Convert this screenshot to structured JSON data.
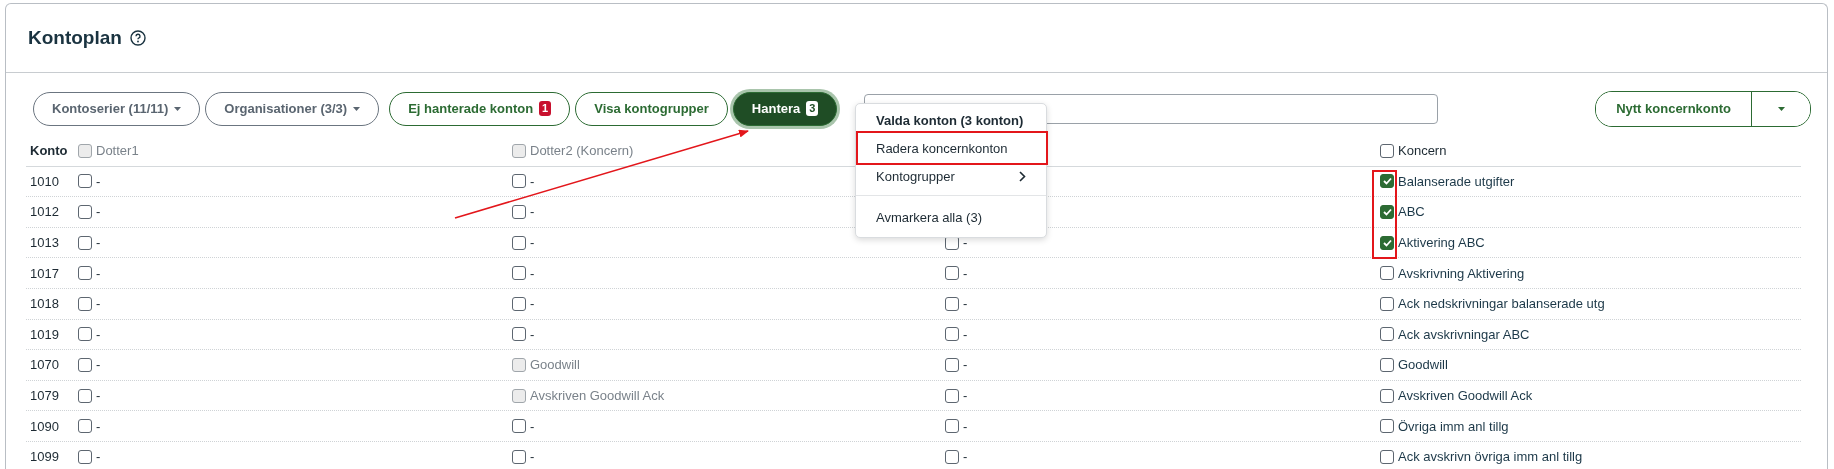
{
  "page": {
    "title": "Kontoplan"
  },
  "toolbar": {
    "buttons": [
      {
        "kind": "dropdown",
        "label": "Kontoserier (11/11)"
      },
      {
        "kind": "dropdown",
        "label": "Organisationer (3/3)"
      },
      {
        "kind": "toggle",
        "label": "Ej hanterade konton",
        "badge": "1",
        "selected": false
      },
      {
        "kind": "toggle",
        "label": "Visa kontogrupper",
        "selected": false
      },
      {
        "kind": "toggle",
        "label": "Hantera",
        "badge": "3",
        "selected": true
      }
    ],
    "new_button": {
      "label": "Nytt koncernkonto"
    }
  },
  "menu": {
    "title": "Valda konton (3 konton)",
    "items": [
      {
        "kind": "action",
        "label": "Radera koncernkonton"
      },
      {
        "kind": "submenu",
        "label": "Kontogrupper"
      },
      {
        "kind": "separator"
      },
      {
        "kind": "action",
        "label": "Avmarkera alla (3)"
      }
    ]
  },
  "table": {
    "first_column": "Konto",
    "columns": {
      "dotter1": {
        "label": "Dotter1",
        "checked": false,
        "disabled": true
      },
      "dotter2": {
        "label": "Dotter2 (Koncern)",
        "checked": false,
        "disabled": true
      },
      "koncern": {
        "label": "Koncern",
        "checked": false,
        "disabled": false
      }
    },
    "rows": [
      {
        "konto": "1010",
        "cells": {
          "dotter1": {
            "text": "-",
            "checked": false,
            "disabled": false
          },
          "dotter2": {
            "text": "-",
            "checked": false,
            "disabled": false
          },
          "koncern": {
            "text": "Balanserade utgifter",
            "checked": true,
            "disabled": false
          }
        }
      },
      {
        "konto": "1012",
        "cells": {
          "dotter1": {
            "text": "-",
            "checked": false,
            "disabled": false
          },
          "dotter2": {
            "text": "-",
            "checked": false,
            "disabled": false
          },
          "koncern": {
            "text": "ABC",
            "checked": true,
            "disabled": false
          }
        }
      },
      {
        "konto": "1013",
        "cells": {
          "dotter1": {
            "text": "-",
            "checked": false,
            "disabled": false
          },
          "dotter2": {
            "text": "-",
            "checked": false,
            "disabled": false
          },
          "column_3": {
            "text": "-",
            "checked": false,
            "disabled": false
          },
          "koncern": {
            "text": "Aktivering ABC",
            "checked": true,
            "disabled": false
          }
        }
      },
      {
        "konto": "1017",
        "cells": {
          "dotter1": {
            "text": "-",
            "checked": false,
            "disabled": false
          },
          "dotter2": {
            "text": "-",
            "checked": false,
            "disabled": false
          },
          "column_3": {
            "text": "-",
            "checked": false,
            "disabled": false
          },
          "koncern": {
            "text": "Avskrivning Aktivering",
            "checked": false,
            "disabled": false
          }
        }
      },
      {
        "konto": "1018",
        "cells": {
          "dotter1": {
            "text": "-",
            "checked": false,
            "disabled": false
          },
          "dotter2": {
            "text": "-",
            "checked": false,
            "disabled": false
          },
          "column_3": {
            "text": "-",
            "checked": false,
            "disabled": false
          },
          "koncern": {
            "text": "Ack nedskrivningar balanserade utg",
            "checked": false,
            "disabled": false
          }
        }
      },
      {
        "konto": "1019",
        "cells": {
          "dotter1": {
            "text": "-",
            "checked": false,
            "disabled": false
          },
          "dotter2": {
            "text": "-",
            "checked": false,
            "disabled": false
          },
          "column_3": {
            "text": "-",
            "checked": false,
            "disabled": false
          },
          "koncern": {
            "text": "Ack avskrivningar ABC",
            "checked": false,
            "disabled": false
          }
        }
      },
      {
        "konto": "1070",
        "cells": {
          "dotter1": {
            "text": "-",
            "checked": false,
            "disabled": false
          },
          "dotter2": {
            "text": "Goodwill",
            "checked": false,
            "disabled": true
          },
          "column_3": {
            "text": "-",
            "checked": false,
            "disabled": false
          },
          "koncern": {
            "text": "Goodwill",
            "checked": false,
            "disabled": false
          }
        }
      },
      {
        "konto": "1079",
        "cells": {
          "dotter1": {
            "text": "-",
            "checked": false,
            "disabled": false
          },
          "dotter2": {
            "text": "Avskriven Goodwill Ack",
            "checked": false,
            "disabled": true
          },
          "column_3": {
            "text": "-",
            "checked": false,
            "disabled": false
          },
          "koncern": {
            "text": "Avskriven Goodwill Ack",
            "checked": false,
            "disabled": false
          }
        }
      },
      {
        "konto": "1090",
        "cells": {
          "dotter1": {
            "text": "-",
            "checked": false,
            "disabled": false
          },
          "dotter2": {
            "text": "-",
            "checked": false,
            "disabled": false
          },
          "column_3": {
            "text": "-",
            "checked": false,
            "disabled": false
          },
          "koncern": {
            "text": "Övriga imm anl tillg",
            "checked": false,
            "disabled": false
          }
        }
      },
      {
        "konto": "1099",
        "cells": {
          "dotter1": {
            "text": "-",
            "checked": false,
            "disabled": false
          },
          "dotter2": {
            "text": "-",
            "checked": false,
            "disabled": false
          },
          "column_3": {
            "text": "-",
            "checked": false,
            "disabled": false
          },
          "koncern": {
            "text": "Ack avskrivn övriga imm anl tillg",
            "checked": false,
            "disabled": false
          }
        }
      }
    ]
  }
}
